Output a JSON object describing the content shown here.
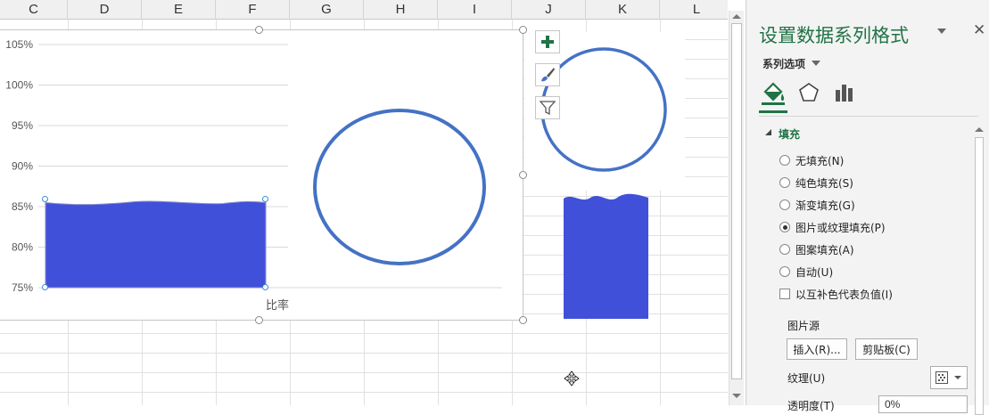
{
  "columns": [
    "C",
    "D",
    "E",
    "F",
    "G",
    "H",
    "I",
    "J",
    "K",
    "L"
  ],
  "chart_data": {
    "type": "area",
    "y_ticks": [
      "105%",
      "100%",
      "95%",
      "90%",
      "85%",
      "80%",
      "75%"
    ],
    "ylim": [
      0.75,
      1.05
    ],
    "xlabel": "比率",
    "series": [
      {
        "values": [
          0.855
        ]
      }
    ],
    "fill_color": "#4150d9",
    "circle_color": "#4472c4"
  },
  "pane": {
    "title": "设置数据系列格式",
    "close": "✕",
    "series_options": "系列选项",
    "section_fill": "填充",
    "options": [
      {
        "label": "无填充(N)",
        "selected": false
      },
      {
        "label": "纯色填充(S)",
        "selected": false
      },
      {
        "label": "渐变填充(G)",
        "selected": false
      },
      {
        "label": "图片或纹理填充(P)",
        "selected": true
      },
      {
        "label": "图案填充(A)",
        "selected": false
      },
      {
        "label": "自动(U)",
        "selected": false
      }
    ],
    "invert_label": "以互补色代表负值(I)",
    "picture_source": "图片源",
    "insert_btn": "插入(R)...",
    "clipboard_btn": "剪贴板(C)",
    "texture_label": "纹理(U)",
    "transparency_label": "透明度(T)",
    "transparency_value": "0%"
  },
  "icons": {
    "add": "chart-elements-icon",
    "style": "chart-styles-icon",
    "filter": "chart-filter-icon"
  }
}
